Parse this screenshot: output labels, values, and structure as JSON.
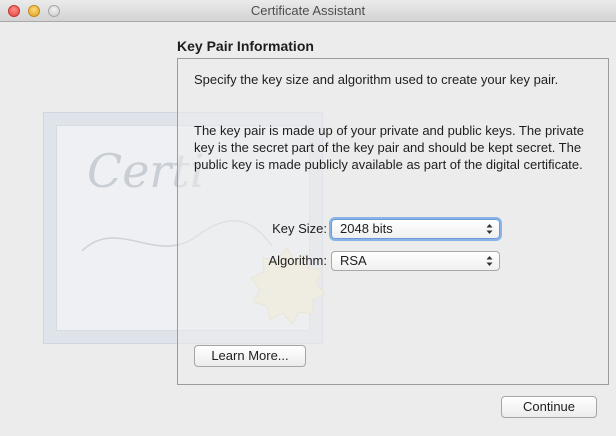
{
  "window": {
    "title": "Certificate Assistant"
  },
  "background": {
    "watermark_text": "Certi"
  },
  "section": {
    "heading": "Key Pair Information",
    "intro": "Specify the key size and algorithm used to create your key pair.",
    "description": "The key pair is made up of your private and public keys. The private key is the secret part of the key pair and should be kept secret. The public key is made publicly available as part of the digital certificate."
  },
  "form": {
    "key_size": {
      "label": "Key Size:",
      "value": "2048 bits"
    },
    "algorithm": {
      "label": "Algorithm:",
      "value": "RSA"
    }
  },
  "buttons": {
    "learn_more": "Learn More...",
    "continue": "Continue"
  }
}
